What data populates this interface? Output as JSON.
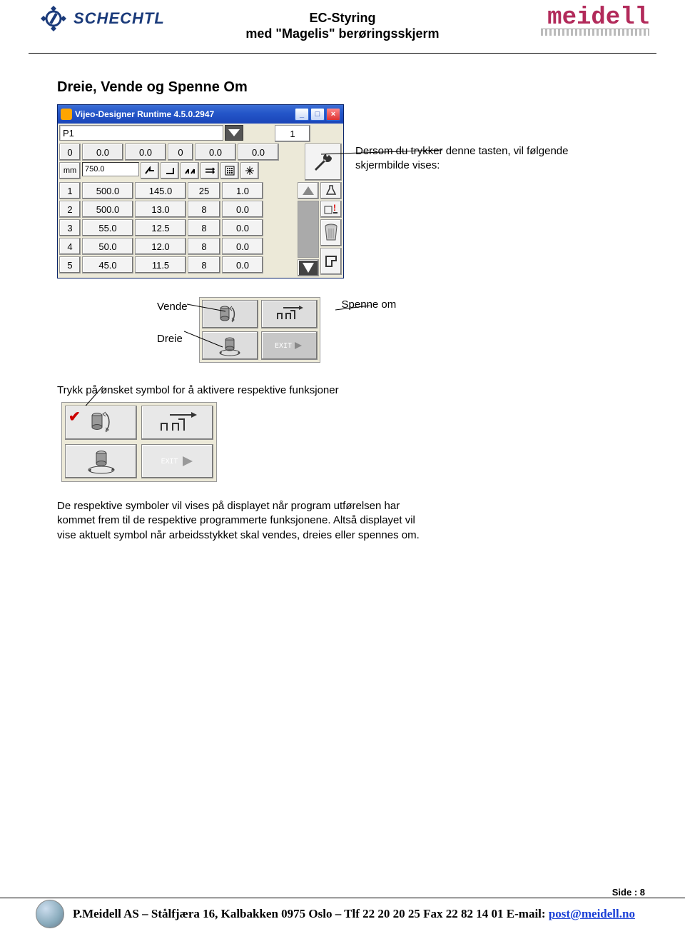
{
  "header": {
    "title_line1": "EC-Styring",
    "title_line2": "med \"Magelis\" berøringsskjerm",
    "left_brand": "SCHECHTL",
    "right_brand": "meidell"
  },
  "section_heading": "Dreie, Vende og Spenne Om",
  "window": {
    "title": "Vijeo-Designer Runtime 4.5.0.2947",
    "p1_label": "P1",
    "counter": "1",
    "header_row": [
      "0",
      "0.0",
      "0.0",
      "0",
      "0.0",
      "0.0"
    ],
    "mm_label": "mm",
    "mm_value": "750.0",
    "rows": [
      [
        "1",
        "500.0",
        "145.0",
        "25",
        "1.0"
      ],
      [
        "2",
        "500.0",
        "13.0",
        "8",
        "0.0"
      ],
      [
        "3",
        "55.0",
        "12.5",
        "8",
        "0.0"
      ],
      [
        "4",
        "50.0",
        "12.0",
        "8",
        "0.0"
      ],
      [
        "5",
        "45.0",
        "11.5",
        "8",
        "0.0"
      ]
    ]
  },
  "callout1": "Dersom du trykker denne tasten, vil følgende skjermbilde vises:",
  "mid_labels": {
    "vende": "Vende",
    "dreie": "Dreie",
    "spenne": "Spenne om"
  },
  "exit_label": "EXIT",
  "line_trykk": "Trykk på ønsket symbol for å aktivere respektive funksjoner",
  "paragraph": "De respektive symboler vil vises på displayet når program utførelsen har kommet frem til de respektive programmerte funksjonene. Altså displayet vil vise aktuelt symbol når arbeidsstykket skal vendes, dreies eller spennes om.",
  "page_num": "Side : 8",
  "footer": {
    "company": "P.Meidell AS – Stålfjæra 16, Kalbakken 0975 Oslo – Tlf 22 20 20 25  Fax 22 82 14 01  E-mail: ",
    "email": "post@meidell.no"
  },
  "icons": {
    "minimize": "_",
    "maximize": "□",
    "close": "×"
  }
}
